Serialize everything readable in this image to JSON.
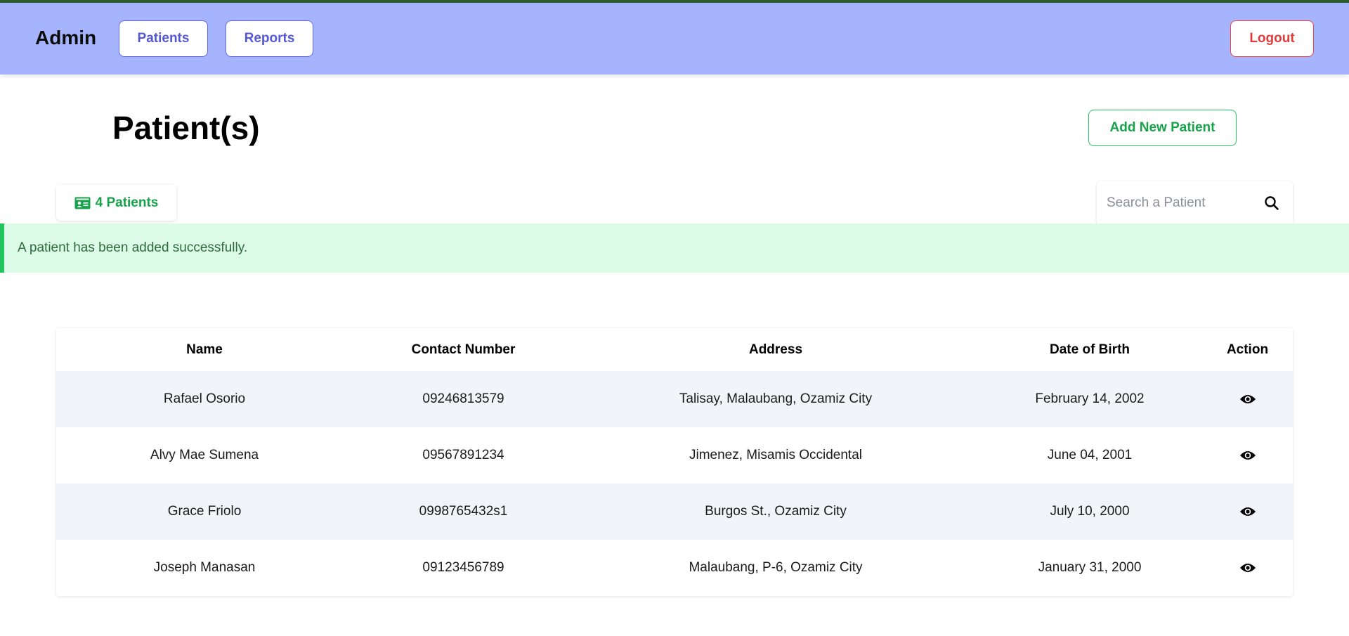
{
  "navbar": {
    "brand": "Admin",
    "patients_label": "Patients",
    "reports_label": "Reports",
    "logout_label": "Logout"
  },
  "page": {
    "title": "Patient(s)",
    "add_button_label": "Add New Patient",
    "patient_count_label": "4 Patients"
  },
  "search": {
    "placeholder": "Search a Patient",
    "value": ""
  },
  "alert": {
    "message": "A patient has been added successfully."
  },
  "table": {
    "headers": {
      "name": "Name",
      "contact": "Contact Number",
      "address": "Address",
      "dob": "Date of Birth",
      "action": "Action"
    },
    "rows": [
      {
        "name": "Rafael Osorio",
        "contact": "09246813579",
        "address": "Talisay, Malaubang, Ozamiz City",
        "dob": "February 14, 2002",
        "action_icon": "eye-icon"
      },
      {
        "name": "Alvy Mae Sumena",
        "contact": "09567891234",
        "address": "Jimenez, Misamis Occidental",
        "dob": "June 04, 2001",
        "action_icon": "eye-icon"
      },
      {
        "name": "Grace Friolo",
        "contact": "0998765432s1",
        "address": "Burgos St., Ozamiz City",
        "dob": "July 10, 2000",
        "action_icon": "eye-icon"
      },
      {
        "name": "Joseph Manasan",
        "contact": "09123456789",
        "address": "Malaubang, P-6, Ozamiz City",
        "dob": "January 31, 2000",
        "action_icon": "eye-icon"
      }
    ]
  },
  "colors": {
    "navbar_bg": "#a5b4fc",
    "nav_accent": "#6366f1",
    "logout_accent": "#ef4444",
    "success_green": "#22c55e",
    "alert_bg": "#dcfce7",
    "row_stripe": "#f1f5f9"
  }
}
